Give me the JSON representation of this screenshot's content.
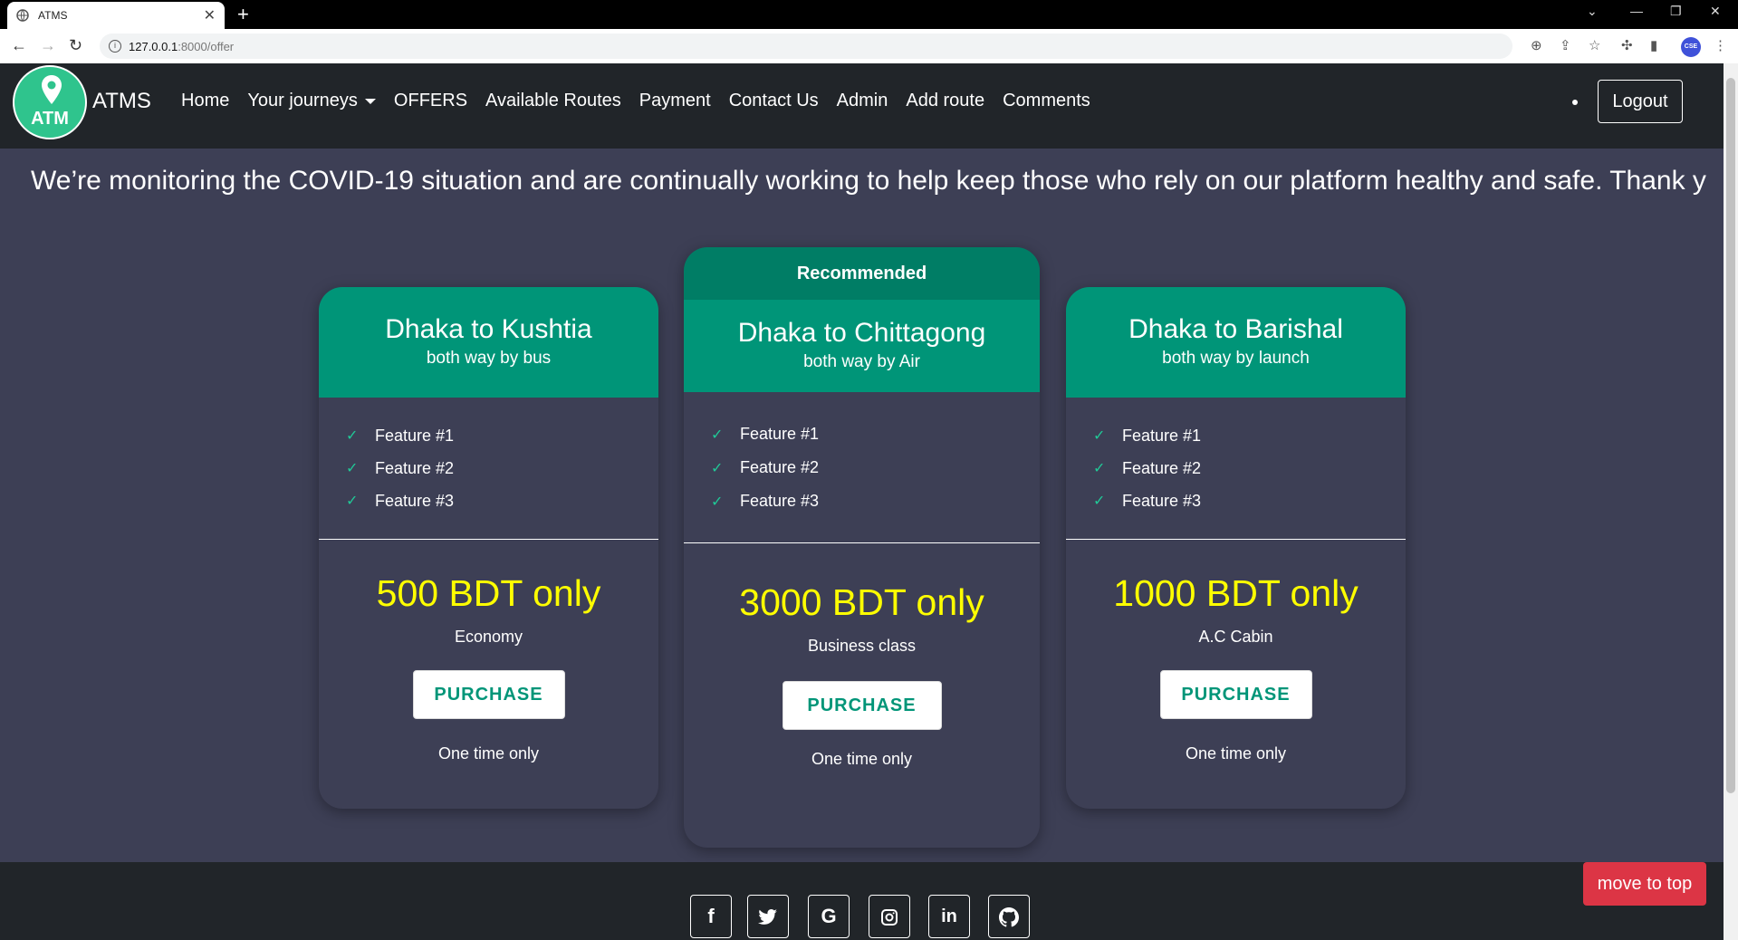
{
  "browser": {
    "tab_title": "ATMS",
    "url_host": "127.0.0.1",
    "url_path": ":8000/offer",
    "profile_label": "CSE"
  },
  "site": {
    "logo_text": "ATM",
    "brand": "ATMS",
    "nav": [
      "Home",
      "Your journeys",
      "OFFERS",
      "Available Routes",
      "Payment",
      "Contact Us",
      "Admin",
      "Add route",
      "Comments"
    ],
    "logout": "Logout"
  },
  "marquee": "We’re monitoring the COVID-19 situation and are continually working to help keep those who rely on our platform healthy and safe. Thank y",
  "offers": [
    {
      "title": "Dhaka to Kushtia",
      "subtitle": "both way by bus",
      "features": [
        "Feature #1",
        "Feature #2",
        "Feature #3"
      ],
      "price": "500 BDT only",
      "tier": "Economy",
      "button": "PURCHASE",
      "note": "One time only"
    },
    {
      "badge": "Recommended",
      "title": "Dhaka to Chittagong",
      "subtitle": "both way by Air",
      "features": [
        "Feature #1",
        "Feature #2",
        "Feature #3"
      ],
      "price": "3000 BDT only",
      "tier": "Business class",
      "button": "PURCHASE",
      "note": "One time only"
    },
    {
      "title": "Dhaka to Barishal",
      "subtitle": "both way by launch",
      "features": [
        "Feature #1",
        "Feature #2",
        "Feature #3"
      ],
      "price": "1000 BDT only",
      "tier": "A.C Cabin",
      "button": "PURCHASE",
      "note": "One time only"
    }
  ],
  "footer": {
    "social_icons": [
      "facebook-icon",
      "twitter-icon",
      "google-icon",
      "instagram-icon",
      "linkedin-icon",
      "github-icon"
    ],
    "move_to_top": "move to top"
  },
  "colors": {
    "accent": "#009578",
    "price": "#ffff00",
    "background": "#3d3f55",
    "navbar": "#212529",
    "danger": "#dc3545"
  }
}
